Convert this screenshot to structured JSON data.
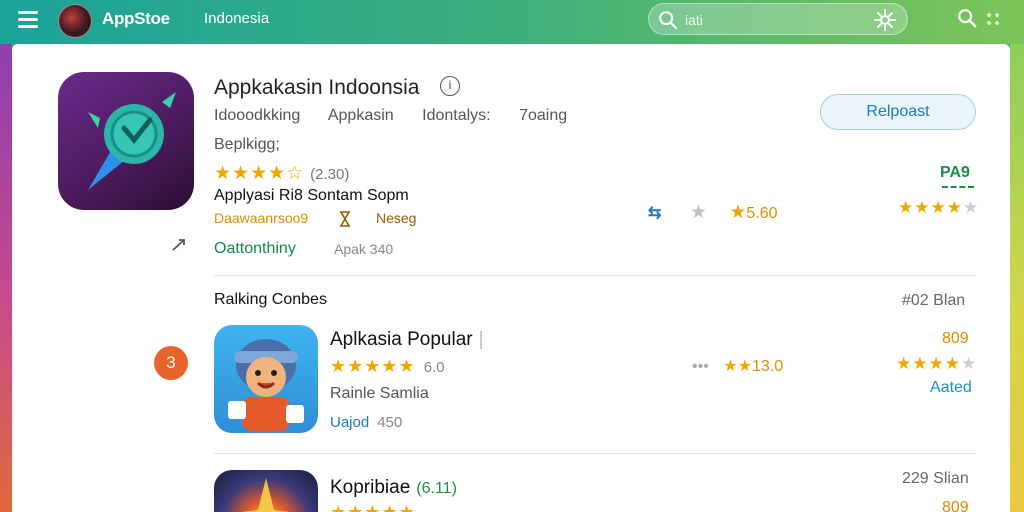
{
  "header": {
    "app_title": "AppStoe",
    "region": "Indonesia",
    "search_placeholder": "iati"
  },
  "featured": {
    "title": "Appkakasin Indoonsia",
    "info_symbol": "i",
    "tags": [
      "Idooodkking",
      "Appkasin",
      "Idontalys:",
      "7oaing"
    ],
    "subcategory": "Beplkigg;",
    "stars": "★★★★☆",
    "rating_count": "(2.30)",
    "description": "Applyasi Ri8 Sontam Sopm",
    "meta_orange": "Daawaanrsoo9",
    "meta_dark": "Neseg",
    "contributor": "Oattonthiny",
    "contributor_meta": "Apak 340",
    "install_label": "Relpoast",
    "price": "PA9",
    "mid_arrow": "⇆",
    "mid_star_gray": "★",
    "mid_star_gold": "★",
    "mid_value": "5.60",
    "right_stars_full": "★★★★",
    "right_stars_dim": "★"
  },
  "ranking": {
    "title": "Ralking Conbes",
    "meta": "#02 Blan"
  },
  "apps": [
    {
      "rank": "3",
      "name": "Aplkasia Popular",
      "bar": "|",
      "stars": "★★★★★",
      "rating": "6.0",
      "developer": "Rainle Samlia",
      "size_label": "Uajod",
      "size_value": "450",
      "mid_dots": "•••",
      "mid_stars": "★★",
      "mid_value": "13.0",
      "price": "809",
      "right_stars_full": "★★★★",
      "right_stars_dim": "★",
      "added": "Aated"
    },
    {
      "name": "Kopribiae",
      "badge": "(6.11)",
      "stars": "★★★★★",
      "meta": "229 Slian",
      "price": "809"
    }
  ]
}
